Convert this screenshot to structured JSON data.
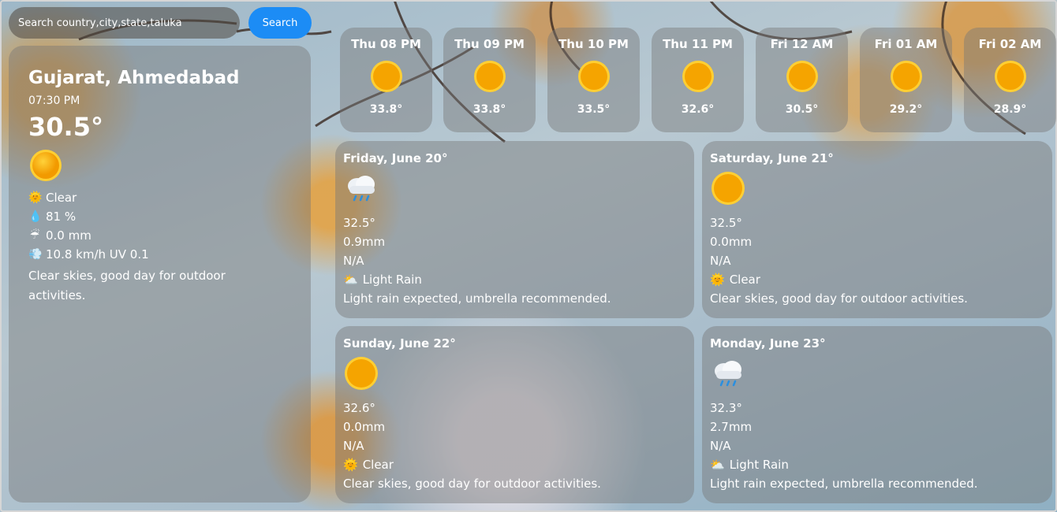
{
  "search": {
    "placeholder": "Search country,city,state,taluka",
    "button_label": "Search"
  },
  "current": {
    "location": "Gujarat, Ahmedabad",
    "time": "07:30 PM",
    "temperature": "30.5°",
    "icon": "sun-icon",
    "condition": "Clear",
    "humidity": "81 %",
    "precipitation": "0.0 mm",
    "wind_uv": "10.8 km/h UV 0.1",
    "description": "Clear skies, good day for outdoor activities."
  },
  "hourly": [
    {
      "label": "Thu 08 PM",
      "temp": "33.8°",
      "icon": "sun-icon"
    },
    {
      "label": "Thu 09 PM",
      "temp": "33.8°",
      "icon": "sun-icon"
    },
    {
      "label": "Thu 10 PM",
      "temp": "33.5°",
      "icon": "sun-icon"
    },
    {
      "label": "Thu 11 PM",
      "temp": "32.6°",
      "icon": "sun-icon"
    },
    {
      "label": "Fri 12 AM",
      "temp": "30.5°",
      "icon": "sun-icon"
    },
    {
      "label": "Fri 01 AM",
      "temp": "29.2°",
      "icon": "sun-icon"
    },
    {
      "label": "Fri 02 AM",
      "temp": "28.9°",
      "icon": "sun-icon"
    }
  ],
  "daily": [
    {
      "date": "Friday, June 20°",
      "icon": "rain-cloud-icon",
      "temp": "32.5°",
      "precip": "0.9mm",
      "extra": "N/A",
      "condition_icon": "partly-cloudy-icon",
      "condition": "Light Rain",
      "description": "Light rain expected, umbrella recommended."
    },
    {
      "date": "Saturday, June 21°",
      "icon": "sun-icon",
      "temp": "32.5°",
      "precip": "0.0mm",
      "extra": "N/A",
      "condition_icon": "sun-small-icon",
      "condition": "Clear",
      "description": "Clear skies, good day for outdoor activities."
    },
    {
      "date": "Sunday, June 22°",
      "icon": "sun-icon",
      "temp": "32.6°",
      "precip": "0.0mm",
      "extra": "N/A",
      "condition_icon": "sun-small-icon",
      "condition": "Clear",
      "description": "Clear skies, good day for outdoor activities."
    },
    {
      "date": "Monday, June 23°",
      "icon": "rain-cloud-icon",
      "temp": "32.3°",
      "precip": "2.7mm",
      "extra": "N/A",
      "condition_icon": "partly-cloudy-icon",
      "condition": "Light Rain",
      "description": "Light rain expected, umbrella recommended."
    }
  ],
  "colors": {
    "accent": "#1c8cf5",
    "sun": "#f5a400",
    "card": "rgba(120,120,120,0.45)"
  }
}
